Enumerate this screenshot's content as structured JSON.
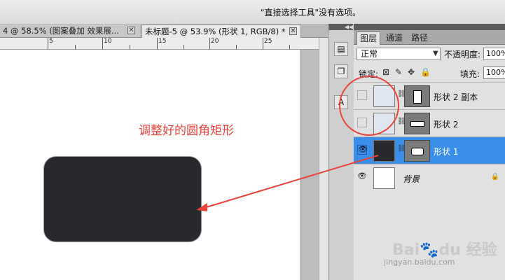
{
  "options_bar": {
    "message": "\"直接选择工具\"没有选项。"
  },
  "doc_tabs": [
    {
      "label": "4 @ 58.5% (图案叠加  效果展...",
      "close": "✕"
    },
    {
      "label": "未标题-5 @ 53.9% (形状 1, RGB/8) *",
      "close": "✕"
    }
  ],
  "ruler": {
    "labels": [
      "5",
      "10",
      "15",
      "20",
      "25"
    ]
  },
  "canvas": {
    "annotation": "调整好的圆角矩形",
    "shape_color": "#28292d",
    "annotation_color": "#e8423a"
  },
  "layers_panel": {
    "tabs": [
      "图层",
      "通道",
      "路径"
    ],
    "blend_mode": "正常",
    "opacity_label": "不透明度:",
    "opacity_value": "100%",
    "lock_label": "锁定:",
    "fill_label": "填充:",
    "fill_value": "100%",
    "layers": [
      {
        "name": "形状 2 副本",
        "visible": false,
        "selected": false
      },
      {
        "name": "形状 2",
        "visible": false,
        "selected": false
      },
      {
        "name": "形状 1",
        "visible": true,
        "selected": true
      },
      {
        "name": "背景",
        "visible": true,
        "selected": false,
        "locked": true
      }
    ]
  },
  "watermark": {
    "brand": "Bai🐾du 经验",
    "url": "jingyan.baidu.com"
  }
}
